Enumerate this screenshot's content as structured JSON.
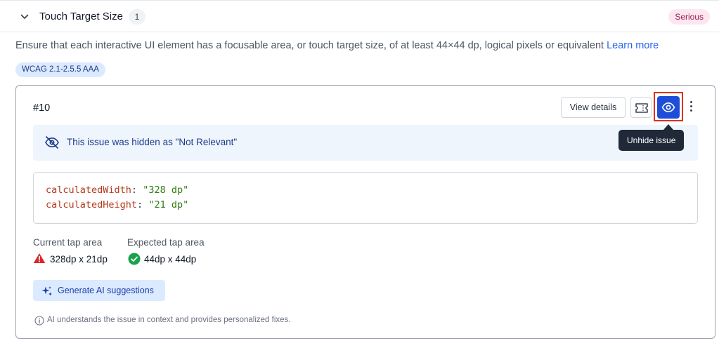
{
  "header": {
    "title": "Touch Target Size",
    "count": "1",
    "severity": "Serious"
  },
  "description": {
    "text": "Ensure that each interactive UI element has a focusable area, or touch target size, of at least 44×44 dp, logical pixels or equivalent ",
    "link": "Learn more"
  },
  "wcag_badge": "WCAG 2.1-2.5.5 AAA",
  "issue": {
    "id": "#10",
    "view_details": "View details",
    "tooltip": "Unhide issue",
    "hidden_notice": "This issue was hidden as \"Not Relevant\"",
    "code": [
      {
        "key": "calculatedWidth",
        "value": "\"328 dp\""
      },
      {
        "key": "calculatedHeight",
        "value": "\"21 dp\""
      }
    ],
    "current_label": "Current tap area",
    "current_value": "328dp x 21dp",
    "expected_label": "Expected tap area",
    "expected_value": "44dp x 44dp",
    "ai_button": "Generate AI suggestions",
    "ai_note": "AI understands the issue in context and provides personalized fixes."
  },
  "icons": {
    "collapse": "chevron-down-icon",
    "ticket": "ticket-icon",
    "unhide": "eye-icon",
    "more": "kebab-menu-icon",
    "hidden": "eye-off-icon",
    "warning": "warning-triangle-icon",
    "success": "check-circle-icon",
    "ai": "sparkle-icon",
    "info": "info-icon"
  },
  "colors": {
    "accent": "#1d4ed8",
    "link": "#2563eb",
    "severity_bg": "#fce7f0",
    "severity_text": "#9d174d",
    "highlight": "#e0301e",
    "warning": "#dc2626",
    "success": "#16a34a",
    "code_key": "#b5391c",
    "code_string": "#2f7d11"
  }
}
